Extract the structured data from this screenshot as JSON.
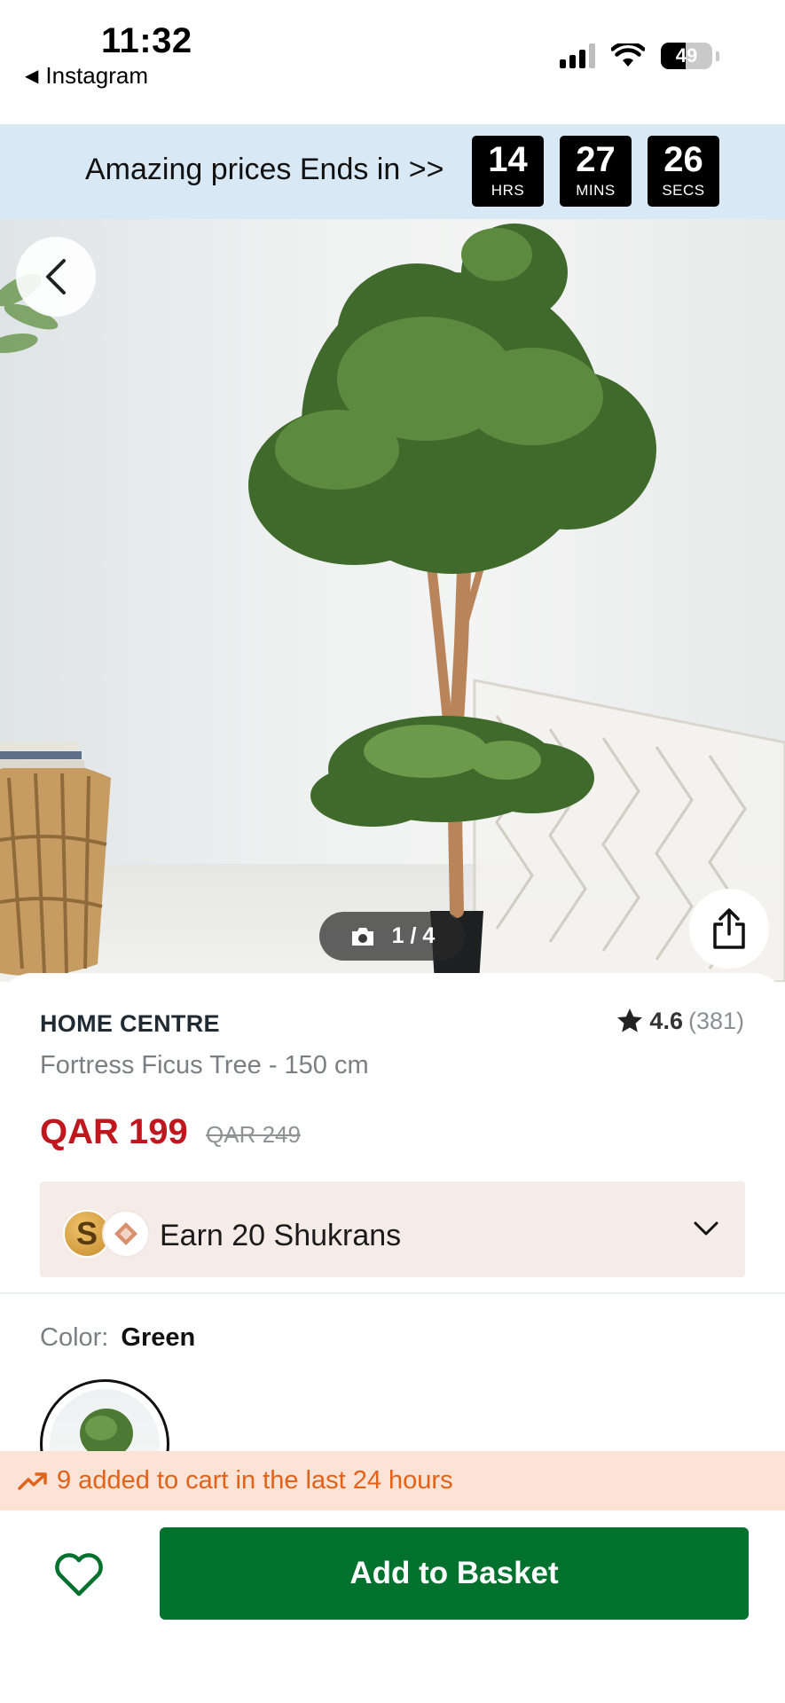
{
  "status_bar": {
    "time": "11:32",
    "back_app": "Instagram",
    "battery": "49",
    "battery_level": 0.49
  },
  "promo": {
    "text": "Amazing prices Ends in >>",
    "countdown": [
      {
        "value": "14",
        "unit": "HRS"
      },
      {
        "value": "27",
        "unit": "MINS"
      },
      {
        "value": "26",
        "unit": "SECS"
      }
    ]
  },
  "gallery": {
    "counter": "1 / 4"
  },
  "product": {
    "brand": "HOME CENTRE",
    "rating": "4.6",
    "rating_count": "(381)",
    "name": "Fortress Ficus Tree - 150 cm",
    "price": "QAR 199",
    "old_price": "QAR 249",
    "shukran_text": "Earn 20 Shukrans",
    "color_label": "Color:",
    "color_value": "Green"
  },
  "cart_notice": "9 added to cart in the last 24 hours",
  "actions": {
    "add_to_basket": "Add to Basket"
  },
  "colors": {
    "promo_bg": "#d8e8f4",
    "price_red": "#c0161e",
    "shukran_bg": "#f5ebe7",
    "notice_bg": "#fce3d6",
    "notice_orange": "#e2621a",
    "cta_green": "#00722e"
  }
}
